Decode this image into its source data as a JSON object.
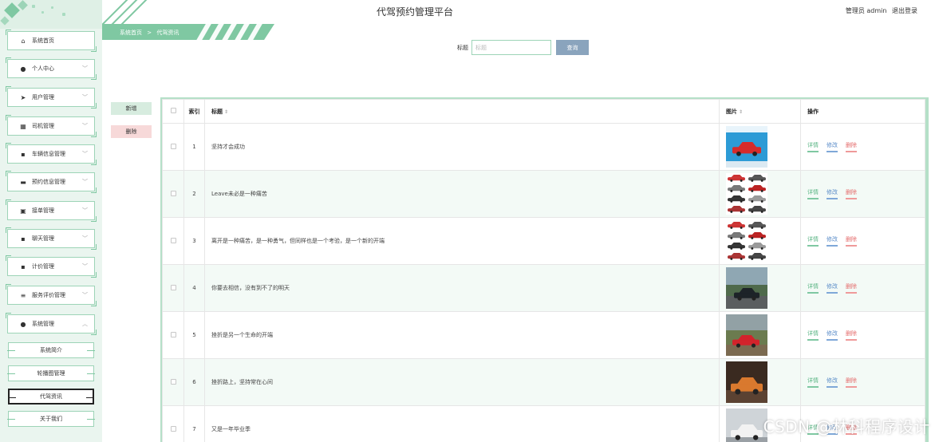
{
  "header": {
    "title": "代驾预约管理平台",
    "user_text": "管理员 admin",
    "logout": "退出登录"
  },
  "breadcrumb": {
    "home": "系统首页",
    "separator": ">",
    "current": "代驾资讯"
  },
  "sidebar": {
    "items": [
      {
        "label": "系统首页",
        "icon": "home-icon",
        "glyph": "⌂",
        "chevron": false
      },
      {
        "label": "个人中心",
        "icon": "person-icon",
        "glyph": "●",
        "chevron": true
      },
      {
        "label": "用户管理",
        "icon": "send-icon",
        "glyph": "➤",
        "chevron": true
      },
      {
        "label": "司机管理",
        "icon": "chart-icon",
        "glyph": "▦",
        "chevron": true
      },
      {
        "label": "车辆信息管理",
        "icon": "grid-icon",
        "glyph": "▪",
        "chevron": true
      },
      {
        "label": "预约信息管理",
        "icon": "briefcase-icon",
        "glyph": "▬",
        "chevron": true
      },
      {
        "label": "接单管理",
        "icon": "clipboard-icon",
        "glyph": "▣",
        "chevron": true
      },
      {
        "label": "聊天管理",
        "icon": "grid-icon",
        "glyph": "▪",
        "chevron": true
      },
      {
        "label": "计价管理",
        "icon": "grid-icon",
        "glyph": "▪",
        "chevron": true
      },
      {
        "label": "服务评价管理",
        "icon": "list-icon",
        "glyph": "≡",
        "chevron": true
      },
      {
        "label": "系统管理",
        "icon": "person-icon",
        "glyph": "●",
        "chevron": true
      }
    ],
    "sub_items": [
      {
        "label": "系统简介",
        "active": false
      },
      {
        "label": "轮播图管理",
        "active": false
      },
      {
        "label": "代驾资讯",
        "active": true
      },
      {
        "label": "关于我们",
        "active": false
      }
    ]
  },
  "search": {
    "label": "标题",
    "placeholder": "标题",
    "button": "查询"
  },
  "actions": {
    "add": "新增",
    "delete": "删除"
  },
  "table": {
    "headers": {
      "index": "索引",
      "title": "标题",
      "image": "图片",
      "ops": "操作"
    },
    "ops": {
      "detail": "详情",
      "edit": "修改",
      "delete": "删除"
    },
    "rows": [
      {
        "index": "1",
        "title": "坚持才会成功",
        "image": "red-car"
      },
      {
        "index": "2",
        "title": "Leave未必是一种痛苦",
        "image": "car-grid"
      },
      {
        "index": "3",
        "title": "离开是一种痛苦，是一种勇气，但同样也是一个考验，是一个新的开端",
        "image": "car-grid"
      },
      {
        "index": "4",
        "title": "你要去相信，没有到不了的明天",
        "image": "dark-car-landscape"
      },
      {
        "index": "5",
        "title": "挫折是另一个生命的开端",
        "image": "red-car-field"
      },
      {
        "index": "6",
        "title": "挫折路上，坚持常在心间",
        "image": "orange-suv"
      },
      {
        "index": "7",
        "title": "又是一年毕业季",
        "image": "white-car"
      }
    ]
  },
  "watermark": "CSDN @林科程序设计",
  "colors": {
    "accent": "#7fc8a2",
    "sidebar_bg": "#eaf5ef",
    "search_button": "#8aa4bd",
    "detail": "#5ab584",
    "edit": "#5a8cc8",
    "delete": "#e46a6a"
  }
}
